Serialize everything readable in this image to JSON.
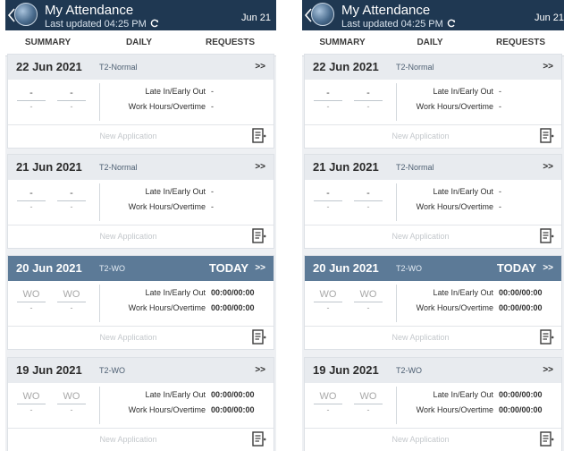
{
  "panels": [
    {
      "header": {
        "title": "My Attendance",
        "subtitle": "Last updated 04:25 PM",
        "date": "Jun 21"
      },
      "tabs": [
        {
          "label": "SUMMARY"
        },
        {
          "label": "DAILY",
          "active": true
        },
        {
          "label": "REQUESTS"
        }
      ],
      "cards": [
        {
          "date": "22 Jun 2021",
          "type": "T2-Normal",
          "today": "",
          "arrow": ">>",
          "in": "-",
          "in_sub": "-",
          "out": "-",
          "out_sub": "-",
          "late_label": "Late In/Early Out",
          "late_value": "-",
          "work_label": "Work Hours/Overtime",
          "work_value": "-",
          "new_application": "New Application"
        },
        {
          "date": "21 Jun 2021",
          "type": "T2-Normal",
          "today": "",
          "arrow": ">>",
          "in": "-",
          "in_sub": "-",
          "out": "-",
          "out_sub": "-",
          "late_label": "Late In/Early Out",
          "late_value": "-",
          "work_label": "Work Hours/Overtime",
          "work_value": "-",
          "new_application": "New Application"
        },
        {
          "date": "20 Jun 2021",
          "type": "T2-WO",
          "today": "TODAY",
          "arrow": ">>",
          "in": "WO",
          "in_sub": "-",
          "out": "WO",
          "out_sub": "-",
          "late_label": "Late In/Early Out",
          "late_value": "00:00/00:00",
          "work_label": "Work Hours/Overtime",
          "work_value": "00:00/00:00",
          "new_application": "New Application"
        },
        {
          "date": "19 Jun 2021",
          "type": "T2-WO",
          "today": "",
          "arrow": ">>",
          "in": "WO",
          "in_sub": "-",
          "out": "WO",
          "out_sub": "-",
          "late_label": "Late In/Early Out",
          "late_value": "00:00/00:00",
          "work_label": "Work Hours/Overtime",
          "work_value": "00:00/00:00",
          "new_application": "New Application"
        }
      ]
    },
    {
      "header": {
        "title": "My Attendance",
        "subtitle": "Last updated 04:25 PM",
        "date": "Jun 21"
      },
      "tabs": [
        {
          "label": "SUMMARY"
        },
        {
          "label": "DAILY",
          "active": true
        },
        {
          "label": "REQUESTS"
        }
      ],
      "cards": [
        {
          "date": "22 Jun 2021",
          "type": "T2-Normal",
          "today": "",
          "arrow": ">>",
          "in": "-",
          "in_sub": "-",
          "out": "-",
          "out_sub": "-",
          "late_label": "Late In/Early Out",
          "late_value": "-",
          "work_label": "Work Hours/Overtime",
          "work_value": "-",
          "new_application": "New Application"
        },
        {
          "date": "21 Jun 2021",
          "type": "T2-Normal",
          "today": "",
          "arrow": ">>",
          "in": "-",
          "in_sub": "-",
          "out": "-",
          "out_sub": "-",
          "late_label": "Late In/Early Out",
          "late_value": "-",
          "work_label": "Work Hours/Overtime",
          "work_value": "-",
          "new_application": "New Application"
        },
        {
          "date": "20 Jun 2021",
          "type": "T2-WO",
          "today": "TODAY",
          "arrow": ">>",
          "in": "WO",
          "in_sub": "-",
          "out": "WO",
          "out_sub": "-",
          "late_label": "Late In/Early Out",
          "late_value": "00:00/00:00",
          "work_label": "Work Hours/Overtime",
          "work_value": "00:00/00:00",
          "new_application": "New Application"
        },
        {
          "date": "19 Jun 2021",
          "type": "T2-WO",
          "today": "",
          "arrow": ">>",
          "in": "WO",
          "in_sub": "-",
          "out": "WO",
          "out_sub": "-",
          "late_label": "Late In/Early Out",
          "late_value": "00:00/00:00",
          "work_label": "Work Hours/Overtime",
          "work_value": "00:00/00:00",
          "new_application": "New Application"
        }
      ]
    }
  ],
  "colors": {
    "appbar": "#1f3852",
    "today_header": "#5c7a97",
    "card_header": "#e8ebef"
  },
  "icons": {
    "back": "chevron-left-icon",
    "app": "globe-app-icon",
    "refresh": "refresh-icon",
    "new_application": "document-edit-icon"
  }
}
